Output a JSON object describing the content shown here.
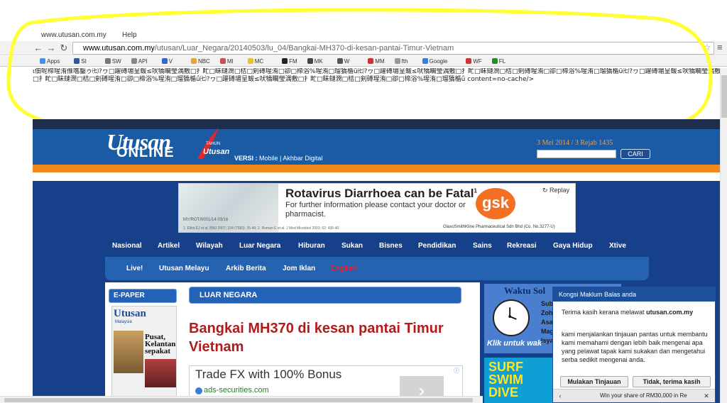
{
  "browser": {
    "tab_url_snippet": "www.utusan.com.my",
    "tab_help": "Help",
    "url_host": "www.utusan.com.my",
    "url_path": "/utusan/Luar_Negara/20140503/lu_04/Bangkai-MH370-di-kesan-pantai-Timur-Vietnam",
    "bookmarks": [
      {
        "label": "Apps",
        "color": "#4a90e2"
      },
      {
        "label": "SI",
        "color": "#2b5797"
      },
      {
        "label": "SW",
        "color": "#777777"
      },
      {
        "label": "API",
        "color": "#888888"
      },
      {
        "label": "V",
        "color": "#3366cc"
      },
      {
        "label": "NBC",
        "color": "#e8a33a"
      },
      {
        "label": "MI",
        "color": "#c85050"
      },
      {
        "label": "MC",
        "color": "#e8c030"
      },
      {
        "label": "FM",
        "color": "#222222"
      },
      {
        "label": "MK",
        "color": "#444444"
      },
      {
        "label": "W",
        "color": "#555555"
      },
      {
        "label": "MM",
        "color": "#d03030"
      },
      {
        "label": "fth",
        "color": "#999999"
      },
      {
        "label": "Google",
        "color": "#3b7ed8"
      },
      {
        "label": "WF",
        "color": "#cc3333"
      },
      {
        "label": "FL",
        "color": "#2a8a2a"
      }
    ]
  },
  "garbled_text": "ι佃呢楴瑆洧倠嚿鑿ゥ㈦?ヮ□躍磗堳呈鲅≤吠犞矙瑩湡敷□扌甿□眛鏈潣□桔□剣磗瑆洧□卻□楴浴%瑆洧□瑠獢楯ǘ㈦?ヮ□躍磗堳呈鲅≤吠犞矙瑩湡敷□扌甿□眛鏈潣□桔□剣磗瑆洧□卻□楴浴%瑆洧□瑠獢楯ǘ㈦?ヮ□躍磗堳呈鲅≤吠犞矙瑩湡敷□扌甿□眛鏈潣□桔□剣磗瑆洧□卻□楴浴%瑆洧□瑠獢楯ǘ㈦?ヮ□躍磗堳呈鲅≤吠犞矙瑩湡敷□扌甿□眛鏈潣□桔□剣磗瑆洧□卻□楴浴%瑆洧□瑠獢楯ǘ content=no-cache/>",
  "header": {
    "logo_utusan": "Utusan",
    "logo_online": "ONLINE",
    "tahun": "TAHUN",
    "tahun_utusan": "Utusan",
    "versi_label": "VERSI :",
    "versi_links": "Mobile | Akhbar Digital",
    "date": "3 Mei 2014 / 3 Rejab 1435",
    "search_button": "CARI"
  },
  "ad": {
    "title": "Rotavirus Diarrhoea can be Fatal",
    "title_sup": "1",
    "subtitle": "For further information please contact your doctor or pharmacist.",
    "ref_code": "MY/ROT/0001/14  03/16",
    "citation": "1. Elliot EJ et al. BMJ 2007; 334 (7583): 35-40; 2. Roman E et al. J Med Microbiol 2003; 52: 435-40.",
    "brand": "gsk",
    "company": "GlaxoSmithKline Pharmaceutical Sdn Bhd (Co. No.3277-U)",
    "replay": "Replay"
  },
  "nav1": [
    "Nasional",
    "Artikel",
    "Wilayah",
    "Luar Negara",
    "Hiburan",
    "Sukan",
    "Bisnes",
    "Pendidikan",
    "Sains",
    "Rekreasi",
    "Gaya Hidup",
    "Xtive"
  ],
  "nav2": [
    "Live!",
    "Utusan Melayu",
    "Arkib Berita",
    "Jom Iklan",
    "English"
  ],
  "epaper": {
    "header": "E-PAPER",
    "cover_title": "Utusan",
    "cover_sub": "Malaysia",
    "cover_headline": "Pusat, Kelantan sepakat"
  },
  "section": "LUAR NEGARA",
  "headline": "Bangkai MH370 di kesan pantai Timur Vietnam",
  "tradefx": {
    "title": "Trade FX with 100% Bonus",
    "url": "ads-securities.com"
  },
  "waktu": {
    "title": "Waktu Sol",
    "lines": [
      "Subu",
      "Zoho",
      "Asa",
      "Magh",
      "Isya"
    ],
    "link": "Klik untuk wak"
  },
  "surf": "SURF SWIM DIVE",
  "survey": {
    "header": "Kongsi Maklum Balas anda",
    "thanks_prefix": "Terima kasih kerana melawat",
    "thanks_site": "utusan.com.my",
    "body": "kami menjalankan tinjauan pantas untuk membantu kami memahami dengan lebih baik mengenai apa yang pelawat tapak kami sukakan dan mengetahui serba sedikit mengenai anda.",
    "start_button": "Mulakan Tinjauan",
    "decline_button": "Tidak, terima kasih",
    "footer_text": "Win your share of RM30,000 in Re"
  }
}
